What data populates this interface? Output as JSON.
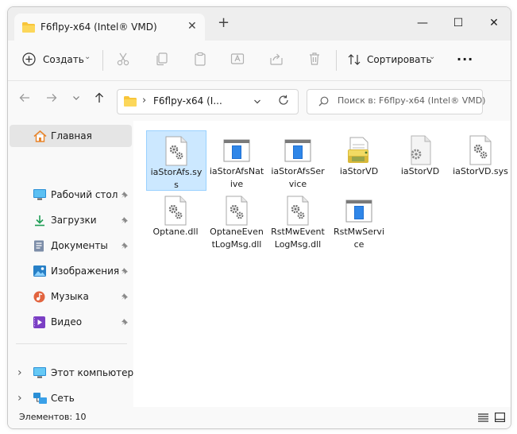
{
  "window": {
    "tab_title": "F6flpy-x64 (Intel® VMD)",
    "tab_close": "✕",
    "new_tab": "+",
    "minimize": "—",
    "maximize": "☐",
    "close": "✕"
  },
  "toolbar": {
    "create_label": "Создать",
    "create_chevron": "⌄",
    "sort_label": "Сортировать",
    "sort_chevron": "⌄",
    "more_label": "···"
  },
  "address": {
    "path_chevron": "›",
    "path": "F6flpy-x64 (I...",
    "dropdown": "⌄",
    "refresh": "⟳",
    "search_placeholder": "Поиск в: F6flpy-x64 (Intel® VMD)"
  },
  "sidebar": {
    "home": "Главная",
    "quick": [
      {
        "label": "Рабочий стол"
      },
      {
        "label": "Загрузки"
      },
      {
        "label": "Документы"
      },
      {
        "label": "Изображения"
      },
      {
        "label": "Музыка"
      },
      {
        "label": "Видео"
      }
    ],
    "pin": "📌",
    "chev": "›",
    "this_pc": "Этот компьютер",
    "network": "Сеть"
  },
  "files": [
    {
      "name": "iaStorAfs.sys",
      "icon": "settings-file-icon"
    },
    {
      "name": "iaStorAfsNative",
      "icon": "app-window-icon"
    },
    {
      "name": "iaStorAfsService",
      "icon": "app-window-icon"
    },
    {
      "name": "iaStorVD",
      "icon": "setup-info-icon"
    },
    {
      "name": "iaStorVD",
      "icon": "catalog-file-icon"
    },
    {
      "name": "iaStorVD.sys",
      "icon": "settings-file-icon"
    },
    {
      "name": "Optane.dll",
      "icon": "settings-file-icon"
    },
    {
      "name": "OptaneEventLogMsg.dll",
      "icon": "settings-file-icon"
    },
    {
      "name": "RstMwEventLogMsg.dll",
      "icon": "settings-file-icon"
    },
    {
      "name": "RstMwService",
      "icon": "app-window-icon"
    }
  ],
  "status": {
    "count": "Элементов: 10"
  }
}
